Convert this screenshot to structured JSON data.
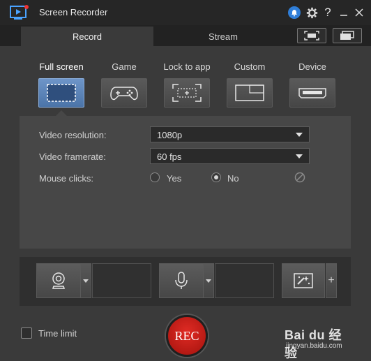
{
  "window": {
    "title": "Screen Recorder"
  },
  "tabs": [
    {
      "label": "Record"
    },
    {
      "label": "Stream"
    }
  ],
  "capture_modes": [
    {
      "label": "Full screen",
      "icon": "full-screen-icon",
      "active": true
    },
    {
      "label": "Game",
      "icon": "gamepad-icon",
      "active": false
    },
    {
      "label": "Lock to app",
      "icon": "lock-to-app-icon",
      "active": false
    },
    {
      "label": "Custom",
      "icon": "custom-region-icon",
      "active": false
    },
    {
      "label": "Device",
      "icon": "device-icon",
      "active": false
    }
  ],
  "settings": {
    "resolution_label": "Video resolution:",
    "resolution_value": "1080p",
    "framerate_label": "Video framerate:",
    "framerate_value": "60 fps",
    "mouse_clicks_label": "Mouse clicks:",
    "mouse_yes": "Yes",
    "mouse_no": "No",
    "mouse_selected": "No"
  },
  "devices": {
    "webcam_icon": "webcam-icon",
    "microphone_icon": "microphone-icon",
    "effects_icon": "effects-icon",
    "add_label": "+"
  },
  "bottom": {
    "time_limit_label": "Time limit",
    "time_limit_checked": false,
    "rec_label": "REC"
  },
  "watermark": {
    "main": "Bai du 经验",
    "sub": "jingyan.baidu.com"
  },
  "colors": {
    "accent": "#2f7ed8",
    "active_mode": "#5a85bb",
    "rec": "#c41a13"
  }
}
